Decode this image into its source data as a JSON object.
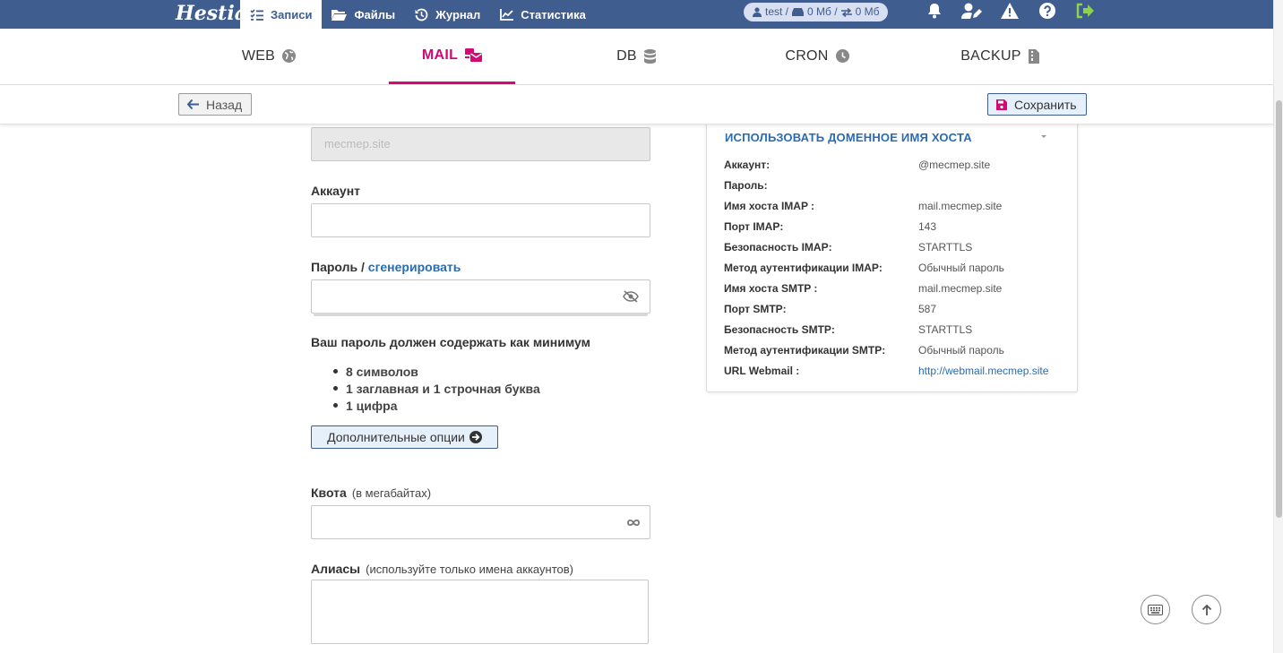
{
  "app": {
    "logo": "Hestia"
  },
  "topnav": {
    "items": [
      {
        "label": "Записи",
        "icon": "list-check-icon",
        "active": true
      },
      {
        "label": "Файлы",
        "icon": "folder-open-icon"
      },
      {
        "label": "Журнал",
        "icon": "history-icon"
      },
      {
        "label": "Статистика",
        "icon": "chart-line-icon"
      }
    ],
    "user": {
      "name": "test /",
      "disk": "0 Мб /",
      "traffic": "0 Мб"
    },
    "icons": [
      "bell-icon",
      "user-pen-icon",
      "warning-icon",
      "help-icon",
      "logout-icon"
    ]
  },
  "tabs": [
    {
      "label": "WEB",
      "icon": "globe-icon"
    },
    {
      "label": "MAIL",
      "icon": "mail-bulk-icon",
      "active": true
    },
    {
      "label": "DB",
      "icon": "database-icon"
    },
    {
      "label": "CRON",
      "icon": "clock-icon"
    },
    {
      "label": "BACKUP",
      "icon": "file-zipper-icon"
    }
  ],
  "toolbar": {
    "back_label": "Назад",
    "save_label": "Сохранить"
  },
  "form": {
    "domain_value": "mecmep.site",
    "account_label": "Аккаунт",
    "password_label": "Пароль /",
    "generate_link": "сгенерировать",
    "requirements_title": "Ваш пароль должен содержать как минимум",
    "requirements": [
      "8 символов",
      "1 заглавная и 1 строчная буква",
      "1 цифра"
    ],
    "advanced_button": "Дополнительные опции",
    "quota_label": "Квота",
    "quota_hint": "(в мегабайтах)",
    "aliases_label": "Алиасы",
    "aliases_hint": "(используйте только имена аккаунтов)"
  },
  "panel": {
    "header": "ИСПОЛЬЗОВАТЬ ДОМЕННОЕ ИМЯ ХОСТА",
    "rows": [
      {
        "k": "Аккаунт:",
        "v": "@mecmep.site"
      },
      {
        "k": "Пароль:",
        "v": ""
      },
      {
        "k": "Имя хоста IMAP :",
        "v": "mail.mecmep.site"
      },
      {
        "k": "Порт IMAP:",
        "v": "143"
      },
      {
        "k": "Безопасность IMAP:",
        "v": "STARTTLS"
      },
      {
        "k": "Метод аутентификации IMAP:",
        "v": "Обычный пароль"
      },
      {
        "k": "Имя хоста SMTP :",
        "v": "mail.mecmep.site"
      },
      {
        "k": "Порт SMTP:",
        "v": "587"
      },
      {
        "k": "Безопасность SMTP:",
        "v": "STARTTLS"
      },
      {
        "k": "Метод аутентификации SMTP:",
        "v": "Обычный пароль"
      },
      {
        "k": "URL Webmail :",
        "v": "http://webmail.mecmep.site",
        "link": true
      }
    ]
  },
  "colors": {
    "topbar": "#3f5d8f",
    "accent": "#d30a73",
    "link": "#2a6cb0"
  }
}
